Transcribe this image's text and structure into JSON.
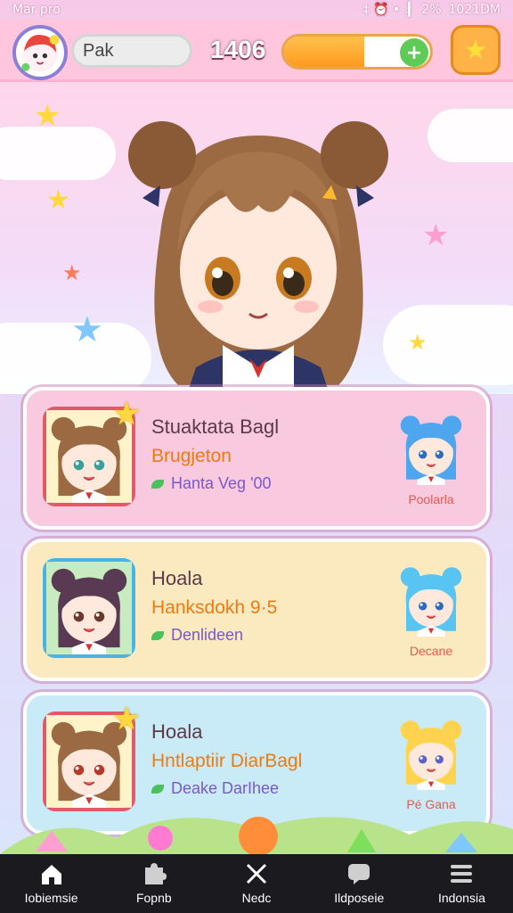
{
  "status_bar": {
    "left": "Mar  pro",
    "icons": "‡ ⏰ • .▎ 2%",
    "time": "1021DM"
  },
  "header": {
    "avatar_icon": "avatar",
    "player_name": "Pak",
    "coins": "1406",
    "energy_percent": 55,
    "energy_plus": "+",
    "star_button_icon": "star-icon"
  },
  "quests": [
    {
      "title": "Stuaktata Bagl",
      "subtitle": "Brugjeton",
      "status": "Hanta Veg '00",
      "right_label": "Poolarla",
      "bg": "#f9c9df",
      "thumb_border": "#e05a6a",
      "has_star": true
    },
    {
      "title": "Hoala",
      "subtitle": "Hanksdokh 9·5",
      "status": "Denlideen",
      "right_label": "Decane",
      "bg": "#fbe9bf",
      "thumb_border": "#48b3e6",
      "has_star": false
    },
    {
      "title": "Hoala",
      "subtitle": "Hntlaptiir DiarBagl",
      "status": "Deake DarIhee",
      "right_label": "Pé Gana",
      "bg": "#c9ebf7",
      "thumb_border": "#e05a6a",
      "has_star": true
    }
  ],
  "nav": [
    {
      "label": "Iobiemsie",
      "icon": "home-icon"
    },
    {
      "label": "Fopnb",
      "icon": "puzzle-icon"
    },
    {
      "label": "Nedc",
      "icon": "crossed-swords-icon"
    },
    {
      "label": "Ildposeie",
      "icon": "chat-icon"
    },
    {
      "label": "Indonsia",
      "icon": "menu-icon"
    }
  ]
}
